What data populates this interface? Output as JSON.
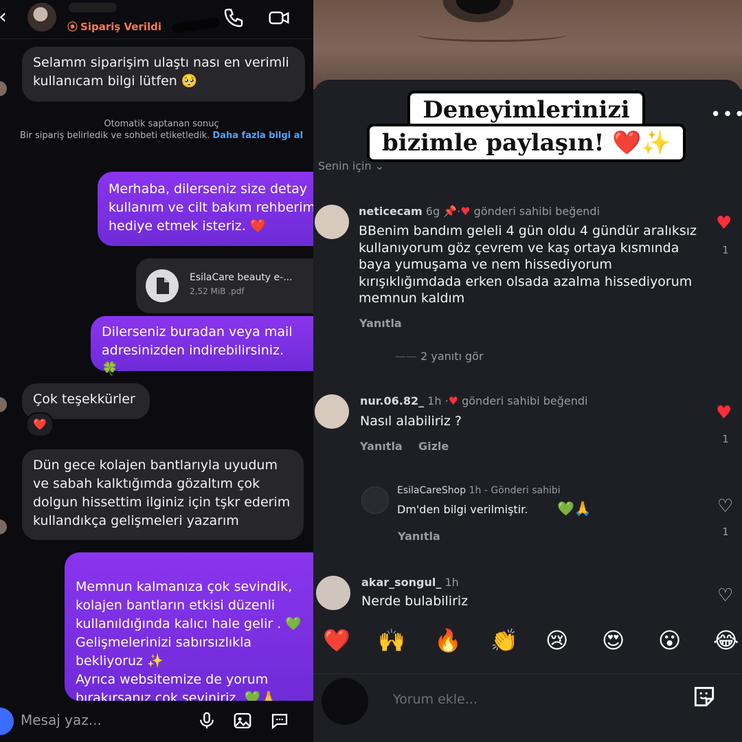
{
  "dm": {
    "back": "‹",
    "status": "Sipariş Verildi",
    "status_dot": "⦿",
    "messages": [
      {
        "dir": "in",
        "text": "Selamm siparişim ulaştı nası en verimli kullanıcam bilgi lütfen 🥺"
      },
      {
        "dir": "out",
        "text": "Merhaba, dilerseniz size detay kullanım ve cilt bakım rehberim hediye etmek isteriz. ❤️"
      },
      {
        "dir": "out",
        "text": "Dilerseniz buradan veya mail adresinizden indirebilirsiniz. 🍀"
      },
      {
        "dir": "in",
        "text": "Çok teşekkürler"
      },
      {
        "dir": "in",
        "text": "Dün gece kolajen bantlarıyla uyudum ve sabah kalktığımda gözaltım çok dolgun hissettim ilginiz için tşkr ederim kullandıkça gelişmeleri yazarım"
      },
      {
        "dir": "out",
        "text": "Memnun kalmanıza çok sevindik, kolajen bantların etkisi düzenli kullanıldığında kalıcı hale gelir . 💚\nGelişmelerinizi sabırsızlıkla bekliyoruz ✨\nAyrıca websitemize de yorum bırakırsanız çok seviniriz. 💚🙏"
      }
    ],
    "system_line1": "Otomatik saptanan sonuç",
    "system_line2": "Bir sipariş belirledik ve sohbeti etiketledik.",
    "system_link": "Daha fazla bilgi al",
    "file": {
      "name": "EsilaCare beauty e-...",
      "meta": "2,52 MiB .pdf"
    },
    "reaction": "❤️",
    "composer_placeholder": "Mesaj yaz..."
  },
  "post": {
    "headline_line1": "Deneyimlerinizi",
    "headline_line2": "bizimle paylaşın! ❤️✨",
    "more": "•••",
    "for_you": "Senin için ⌄",
    "comments": [
      {
        "user": "neticecam",
        "time": "6g",
        "pin": "📌",
        "liked_by_author": "gönderi sahibi beğendi",
        "text": "BBenim bandım geleli 4 gün oldu 4 gündür aralıksız kullanıyorum göz çevrem ve kaş ortaya kısmında baya yumuşama ve nem hissediyorum kırışıklığımdada erken olsada azalma hissediyorum memnun kaldım",
        "reply": "Yanıtla",
        "view_replies": "2 yanıtı gör",
        "likes": "1",
        "liked": true
      },
      {
        "user": "nur.06.82_",
        "time": "1h",
        "liked_by_author": "gönderi sahibi beğendi",
        "text": "Nasıl alabiliriz ?",
        "reply": "Yanıtla",
        "hide": "Gizle",
        "likes": "1",
        "liked": true
      },
      {
        "user": "EsilaCareShop",
        "time": "1h",
        "author_tag": "Gönderi sahibi",
        "text": "Dm'den bilgi verilmiştir.",
        "emoji": "💚🙏",
        "reply": "Yanıtla",
        "likes": "1",
        "liked": false
      },
      {
        "user": "akar_songul_",
        "time": "1h",
        "text": "Nerde bulabiliriz",
        "liked": false
      }
    ],
    "emoji_bar": [
      "❤️",
      "🙌",
      "🔥",
      "👏",
      "😢",
      "😍",
      "😮",
      "😂"
    ],
    "add_comment_placeholder": "Yorum ekle..."
  },
  "colors": {
    "outgoing_bubble": "#7e2ee0",
    "incoming_bubble": "#26262b",
    "heart": "#ff2d3c",
    "status": "#ff7a4d",
    "link": "#4fa3ff"
  }
}
